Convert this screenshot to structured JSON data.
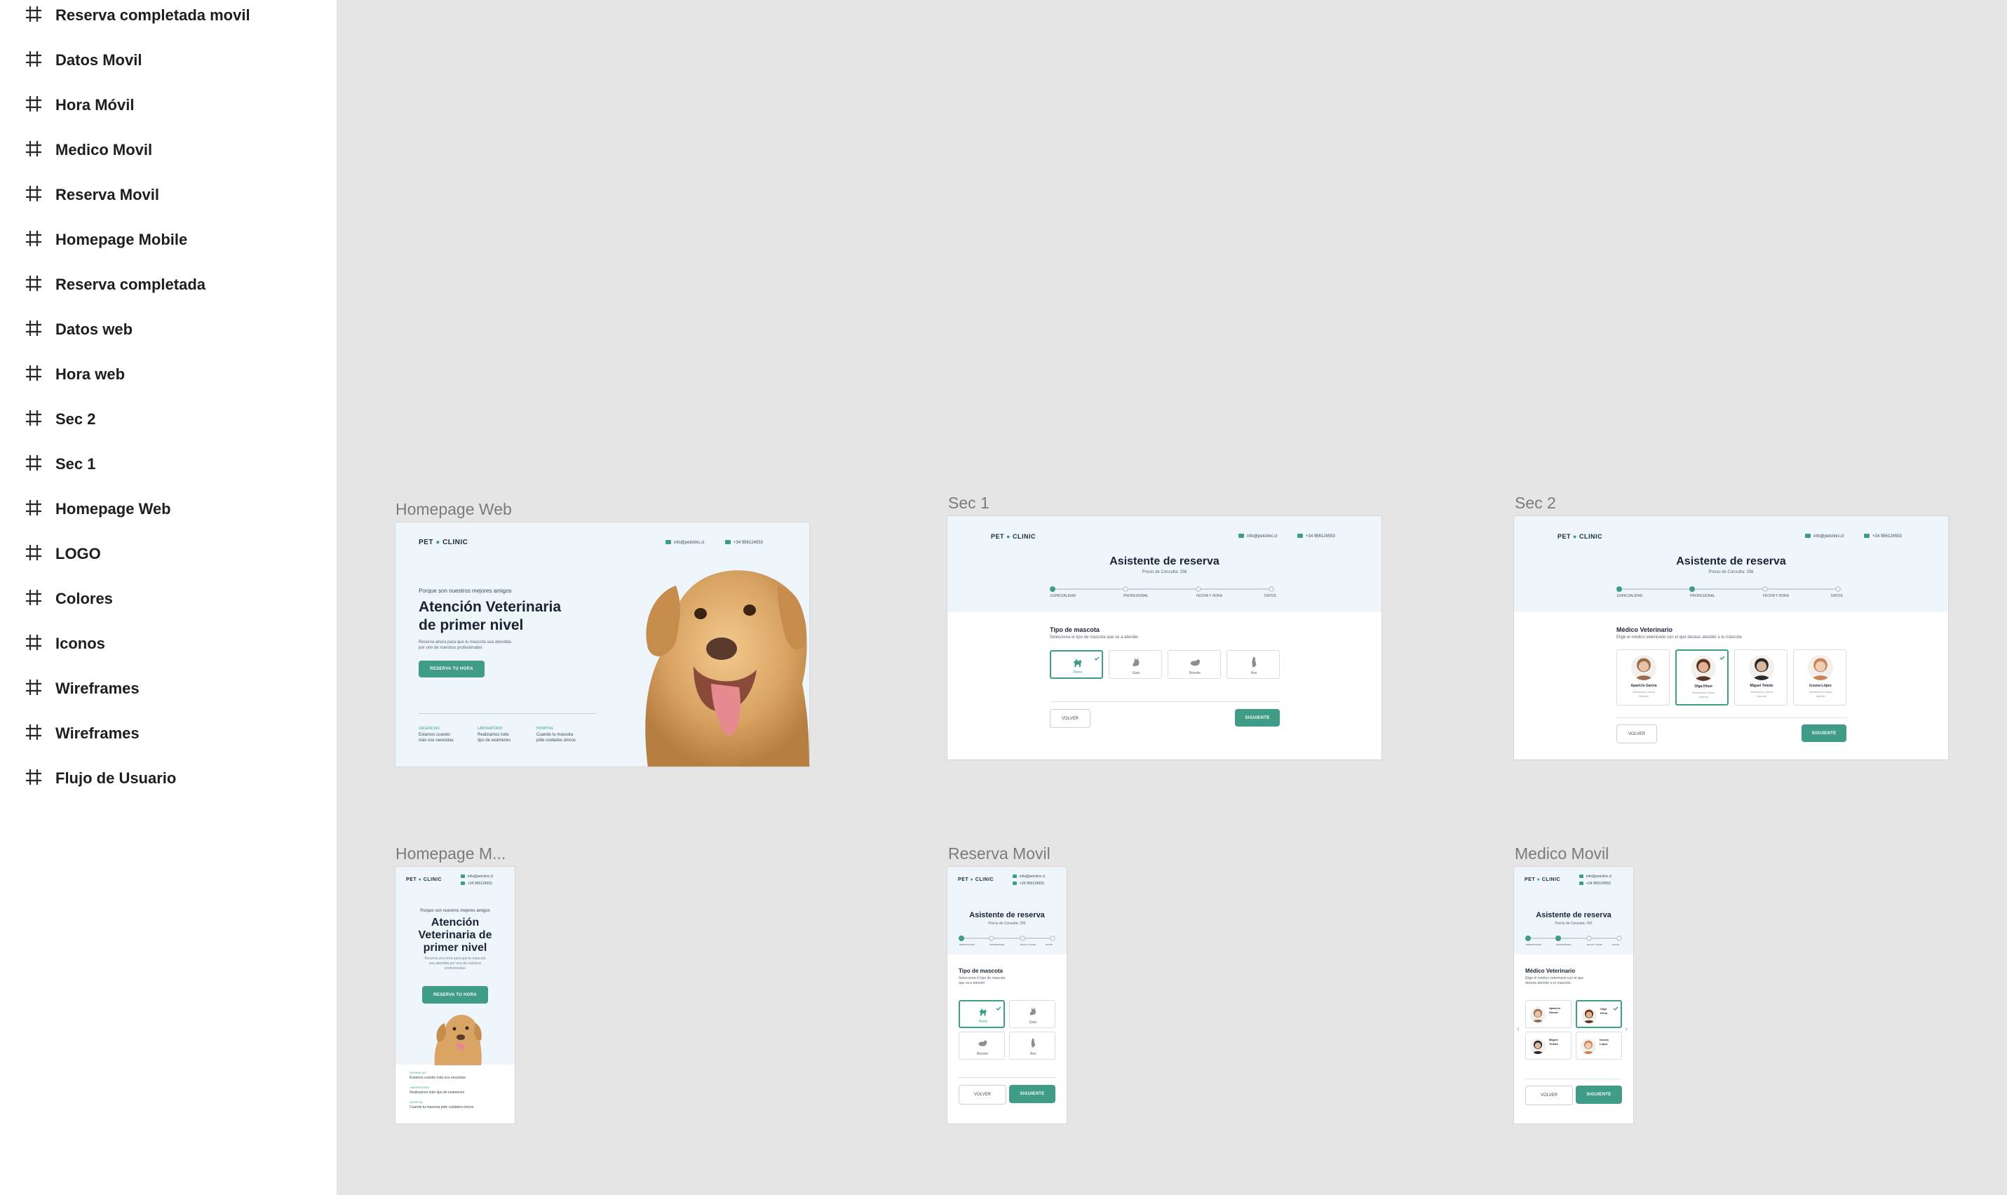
{
  "sidebar": {
    "layers": [
      {
        "label": "Reserva completada movil"
      },
      {
        "label": "Datos Movil"
      },
      {
        "label": "Hora Móvil"
      },
      {
        "label": "Medico Movil"
      },
      {
        "label": "Reserva Movil"
      },
      {
        "label": "Homepage Mobile"
      },
      {
        "label": "Reserva completada"
      },
      {
        "label": "Datos web"
      },
      {
        "label": "Hora web"
      },
      {
        "label": "Sec 2"
      },
      {
        "label": "Sec 1"
      },
      {
        "label": "Homepage Web"
      },
      {
        "label": "LOGO"
      },
      {
        "label": "Colores"
      },
      {
        "label": "Iconos"
      },
      {
        "label": "Wireframes"
      },
      {
        "label": "Wireframes"
      },
      {
        "label": "Flujo de Usuario"
      }
    ],
    "icon": "frame-hash-icon"
  },
  "colors": {
    "accent": "#3f9c86",
    "canvas": "#e5e5e5",
    "header_bg": "#eef5fb"
  },
  "brand": {
    "logo_left": "PET",
    "logo_right": "CLINIC",
    "email": "info@petclinic.cl",
    "phone": "+34 956124553"
  },
  "frames": {
    "homepage_web": {
      "title": "Homepage Web",
      "kicker": "Porque son nuestros mejores amigos",
      "headline_1": "Atención Veterinaria",
      "headline_2": "de primer nivel",
      "desc_1": "Reserva ahora para que tu mascota sea atendida",
      "desc_2": "por uno de nuestros profesionales",
      "cta": "RESERVA TU HORA",
      "features": [
        {
          "label": "URGENCIAS",
          "l1": "Estamos cuando",
          "l2": "más nos necesitas"
        },
        {
          "label": "LABORATORIO",
          "l1": "Realizamos todo",
          "l2": "tipo de exámenes"
        },
        {
          "label": "HOSPITAL",
          "l1": "Cuando tu mascota",
          "l2": "pide cuidados únicos"
        }
      ]
    },
    "sec1": {
      "title": "Sec 1",
      "heading": "Asistente de reserva",
      "price": "Precio de Consulta: 25€",
      "steps": [
        "ESPECIALIDAD",
        "PROFESIONAL",
        "FECHA Y HORA",
        "DATOS"
      ],
      "section_title": "Tipo de mascota",
      "section_sub": "Selecciona el tipo de mascota que se a atender",
      "pets": [
        "Perro",
        "Gato",
        "Roedor",
        "Ave"
      ],
      "back": "VOLVER",
      "next": "SIGUIENTE"
    },
    "sec2": {
      "title": "Sec 2",
      "heading": "Asistente de reserva",
      "price": "Precio de Consulta: 25€",
      "steps": [
        "ESPECIALIDAD",
        "PROFESIONAL",
        "FECHA Y HORA",
        "DATOS"
      ],
      "section_title": "Médico Veterinario",
      "section_sub": "Elige el médico veterinario con el que deseas atender a tu mascota",
      "doctors": [
        {
          "name": "Aparicio García",
          "l1": "Veterinario Clínica",
          "l2": "General"
        },
        {
          "name": "Olga Khun",
          "l1": "Veterinaria Clínica",
          "l2": "Trauma"
        },
        {
          "name": "Miguel Toledo",
          "l1": "Veterinario Clínica",
          "l2": "General"
        },
        {
          "name": "Icsuna López",
          "l1": "Veterinaria Clínica",
          "l2": "Interna"
        }
      ],
      "back": "VOLVER",
      "next": "SIGUIENTE"
    },
    "homepage_mobile": {
      "title": "Homepage M...",
      "kicker": "Porque son nuestros mejores amigos",
      "h1": "Atención",
      "h2": "Veterinaria de",
      "h3": "primer nivel",
      "d1": "Reserva una hora para que tu mascota",
      "d2": "sea atendida por uno de nuestros",
      "d3": "profesionales",
      "cta": "RESERVA TU HORA",
      "features": [
        {
          "label": "URGENCIAS",
          "text": "Estamos cuando más nos necesitas"
        },
        {
          "label": "LABORATORIO",
          "text": "Realizamos todo tipo de exámenes"
        },
        {
          "label": "HOSPITAL",
          "text": "Cuando tu mascota pide cuidados únicos"
        }
      ]
    },
    "reserva_movil": {
      "title": "Reserva Movil",
      "heading": "Asistente de reserva",
      "price": "Precio de Consulta: 25€",
      "steps": [
        "ESPECIALIDAD",
        "PROFESIONAL",
        "FECHA Y HORA",
        "DATOS"
      ],
      "section_title": "Tipo de mascota",
      "s1": "Selecciona el tipo de mascota",
      "s2": "que va a atender",
      "pets": [
        "Perro",
        "Gato",
        "Roedor",
        "Ave"
      ],
      "back": "VOLVER",
      "next": "SIGUIENTE"
    },
    "medico_movil": {
      "title": "Medico Movil",
      "heading": "Asistente de reserva",
      "price": "Precio de Consulta: 25€",
      "steps": [
        "ESPECIALIDAD",
        "PROFESIONAL",
        "FECHA Y HORA",
        "DATOS"
      ],
      "section_title": "Médico Veterinario",
      "s1": "Elige el médico veterinario con el que",
      "s2": "deseas atender a tu mascota",
      "doctors": [
        {
          "n1": "Aparicio",
          "n2": "García"
        },
        {
          "n1": "Olga",
          "n2": "Khun"
        },
        {
          "n1": "Miguel",
          "n2": "Toledo"
        },
        {
          "n1": "Icsuna",
          "n2": "López"
        }
      ],
      "back": "VOLVER",
      "next": "SIGUIENTE"
    }
  }
}
